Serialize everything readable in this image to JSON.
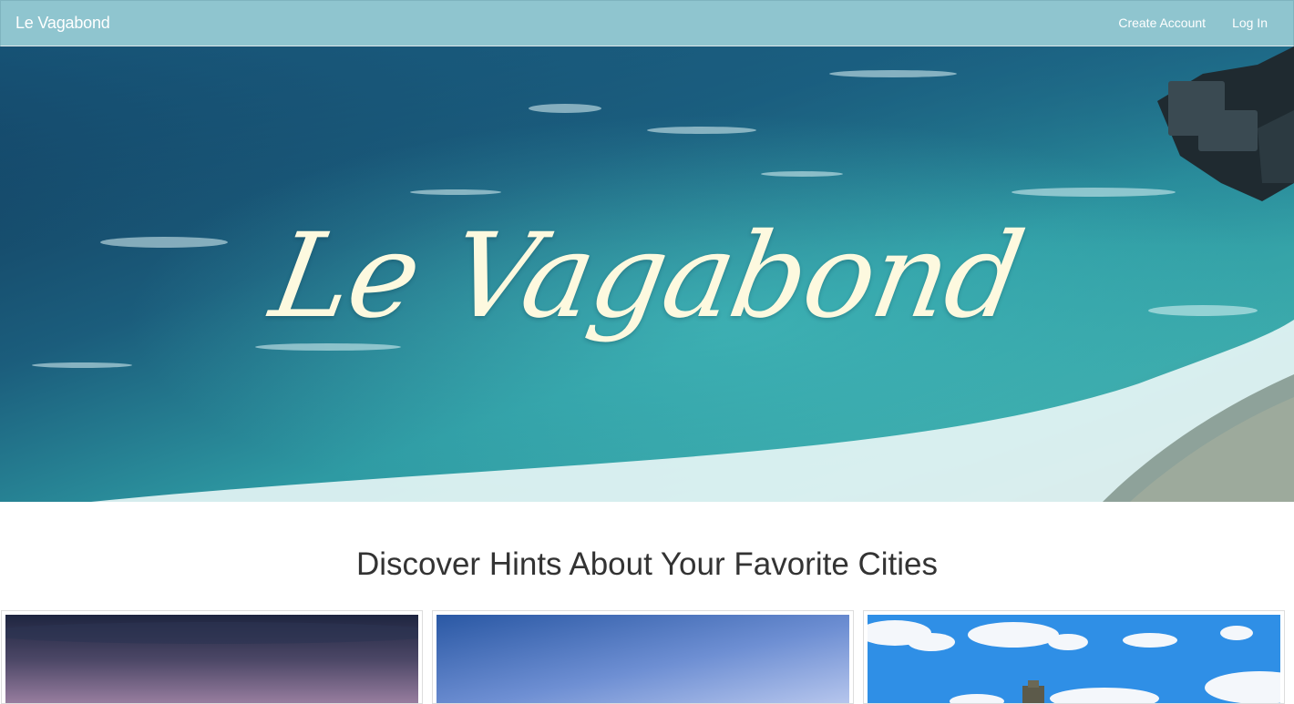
{
  "navbar": {
    "brand": "Le Vagabond",
    "links": [
      {
        "label": "Create Account"
      },
      {
        "label": "Log In"
      }
    ],
    "color": "#8fc5cf"
  },
  "hero": {
    "title": "Le Vagabond",
    "title_color": "#fdf9df"
  },
  "section": {
    "heading": "Discover Hints About Your Favorite Cities"
  },
  "cards": [
    {
      "image": "city-dusk-photo"
    },
    {
      "image": "blue-sky-photo"
    },
    {
      "image": "castle-clouds-photo"
    }
  ]
}
